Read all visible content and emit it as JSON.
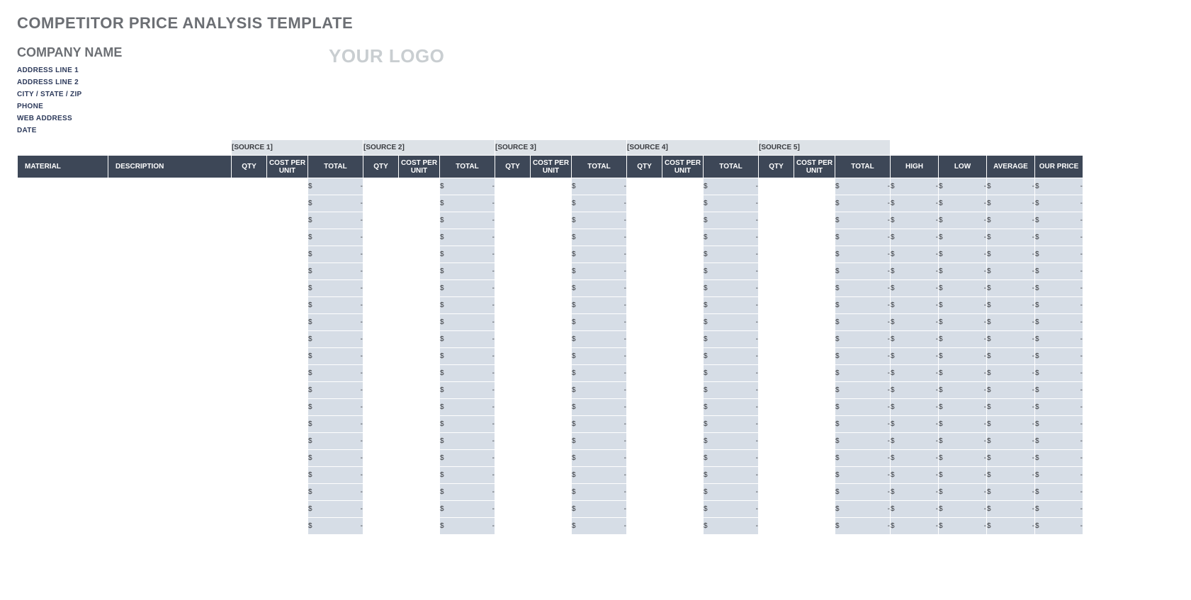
{
  "title": "COMPETITOR PRICE ANALYSIS TEMPLATE",
  "company": {
    "name": "COMPANY NAME",
    "address1": "ADDRESS LINE 1",
    "address2": "ADDRESS LINE 2",
    "citystatezip": "CITY / STATE / ZIP",
    "phone": "PHONE",
    "web": "WEB ADDRESS",
    "date": "DATE"
  },
  "logo_placeholder": "YOUR LOGO",
  "sources": [
    "[SOURCE 1]",
    "[SOURCE 2]",
    "[SOURCE 3]",
    "[SOURCE 4]",
    "[SOURCE 5]"
  ],
  "columns": {
    "material": "MATERIAL",
    "description": "DESCRIPTION",
    "qty": "QTY",
    "cost_per_unit": "COST PER UNIT",
    "total": "TOTAL",
    "high": "HIGH",
    "low": "LOW",
    "average": "AVERAGE",
    "our_price": "OUR PRICE"
  },
  "currency_symbol": "$",
  "empty_value": "-",
  "row_count": 21
}
